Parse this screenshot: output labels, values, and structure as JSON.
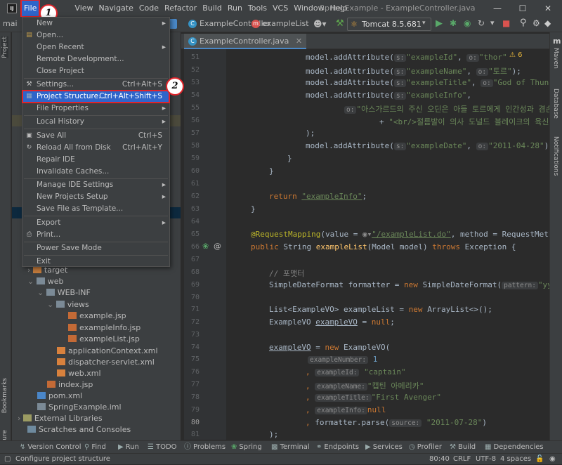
{
  "menubar": {
    "items": [
      "File",
      "View",
      "Navigate",
      "Code",
      "Refactor",
      "Build",
      "Run",
      "Tools",
      "VCS",
      "Window",
      "Help"
    ],
    "window_title": "SpringExample - ExampleController.java"
  },
  "toolbar": {
    "run_config": "Tomcat 8.5.681",
    "breadcrumb_left": "mai"
  },
  "tabs": {
    "nav1": "ExampleController",
    "nav2": "exampleList",
    "editor_tab": "ExampleController.java"
  },
  "badges": {
    "one": "1",
    "two": "2"
  },
  "file_menu": {
    "new": "New",
    "open": "Open...",
    "open_recent": "Open Recent",
    "remote_dev": "Remote Development...",
    "close_project": "Close Project",
    "settings": "Settings...",
    "settings_sc": "Ctrl+Alt+S",
    "project_structure": "Project Structure...",
    "project_structure_sc": "Ctrl+Alt+Shift+S",
    "file_properties": "File Properties",
    "local_history": "Local History",
    "save_all": "Save All",
    "save_all_sc": "Ctrl+S",
    "reload": "Reload All from Disk",
    "reload_sc": "Ctrl+Alt+Y",
    "repair": "Repair IDE",
    "invalidate": "Invalidate Caches...",
    "manage_ide": "Manage IDE Settings",
    "new_projects_setup": "New Projects Setup",
    "save_template": "Save File as Template...",
    "export": "Export",
    "print": "Print...",
    "power_save": "Power Save Mode",
    "exit": "Exit"
  },
  "tree": {
    "target": "target",
    "web": "web",
    "webinf": "WEB-INF",
    "views": "views",
    "example": "example.jsp",
    "exampleInfo": "exampleInfo.jsp",
    "exampleList": "exampleList.jsp",
    "appctx": "applicationContext.xml",
    "dispatcher": "dispatcher-servlet.xml",
    "webxml": "web.xml",
    "index": "index.jsp",
    "pom": "pom.xml",
    "iml": "SpringExample.iml",
    "extlib": "External Libraries",
    "scratches": "Scratches and Consoles"
  },
  "left_tabs": {
    "project": "Project",
    "bookmarks": "Bookmarks",
    "structure": "Structure"
  },
  "right_tabs": {
    "maven": "Maven",
    "database": "Database",
    "notifications": "Notifications"
  },
  "warning_count": "6",
  "code": {
    "l51a": "model.addAttribute(",
    "l51h": "s:",
    "l51s": "\"exampleId\"",
    "l51h2": "o:",
    "l51s2": "\"thor\"",
    "l52a": "model.addAttribute(",
    "l52h": "s:",
    "l52s": "\"exampleName\"",
    "l52h2": "o:",
    "l52s2": "\"토르\"",
    "l52e": ");",
    "l53a": "model.addAttribute(",
    "l53h": "s:",
    "l53s": "\"exampleTitle\"",
    "l53h2": "o:",
    "l53s2": "\"God of Thund",
    "l54a": "model.addAttribute(",
    "l54h": "s:",
    "l54s": "\"exampleInfo\"",
    "l54e": ",",
    "l55h": "o:",
    "l55s": "\"아스가르드의 주신 오딘은 아들 토르에게 인간성과 겸손",
    "l56a": "+ ",
    "l56s": "\"<br/>절름발이 의사 도널드 블레이크의 육신",
    "l57": ");",
    "l58a": "model.addAttribute(",
    "l58h": "s:",
    "l58s": "\"exampleDate\"",
    "l58h2": "o:",
    "l58s2": "\"2011-04-28\"",
    "l58e": ");",
    "l59": "}",
    "l60": "}",
    "l62k": "return ",
    "l62s": "\"exampleInfo\"",
    "l62e": ";",
    "l63": "}",
    "l65a": "@RequestMapping",
    "l65b": "(value = ",
    "l65s": "\"/exampleList.do\"",
    "l65c": ", method = RequestMeth",
    "l66k": "public ",
    "l66t": "String ",
    "l66f": "exampleList",
    "l66p": "(Model model) ",
    "l66k2": "throws ",
    "l66e": "Exception {",
    "l68": "// 포맷터",
    "l69a": "SimpleDateFormat formatter = ",
    "l69k": "new ",
    "l69b": "SimpleDateFormat(",
    "l69h": "pattern:",
    "l69s": "\"yyyy",
    "l71a": "List<ExampleVO> exampleList = ",
    "l71k": "new ",
    "l71b": "ArrayList<>();",
    "l72a": "ExampleVO ",
    "l72v": "exampleVO",
    "l72b": " = ",
    "l72k": "null",
    "l72e": ";",
    "l74v": "exampleVO",
    "l74a": " = ",
    "l74k": "new ",
    "l74b": "ExampleVO(",
    "l75h": "exampleNumber:",
    "l75n": "1",
    "l76c": ",",
    "l76h": "exampleId:",
    "l76s": "\"captain\"",
    "l77c": ",",
    "l77h": "exampleName:",
    "l77s": "\"캡틴 아메리카\"",
    "l78c": ",",
    "l78h": "exampleTitle:",
    "l78s": "\"First Avenger\"",
    "l79c": ",",
    "l79h": "exampleInfo:",
    "l79k": "null",
    "l80c": ",",
    "l80a": " formatter.parse(",
    "l80h": "source:",
    "l80s": "\"2011-07-28\"",
    "l80e": ")",
    "l81": ");"
  },
  "line_numbers": [
    "51",
    "52",
    "53",
    "54",
    "55",
    "56",
    "57",
    "58",
    "59",
    "60",
    "61",
    "62",
    "63",
    "64",
    "65",
    "66",
    "67",
    "68",
    "69",
    "70",
    "71",
    "72",
    "73",
    "74",
    "75",
    "76",
    "77",
    "78",
    "79",
    "80",
    "81"
  ],
  "bottom": {
    "vc": "Version Control",
    "find": "Find",
    "run": "Run",
    "todo": "TODO",
    "problems": "Problems",
    "spring": "Spring",
    "terminal": "Terminal",
    "endpoints": "Endpoints",
    "services": "Services",
    "profiler": "Profiler",
    "build": "Build",
    "deps": "Dependencies"
  },
  "status": {
    "msg": "Configure project structure",
    "pos": "80:40",
    "crlf": "CRLF",
    "enc": "UTF-8",
    "indent": "4 spaces"
  },
  "colors": {
    "accent": "#2f65ca",
    "highlight_border": "#e0242a",
    "background": "#2b2b2b",
    "panel": "#3c3f41"
  }
}
